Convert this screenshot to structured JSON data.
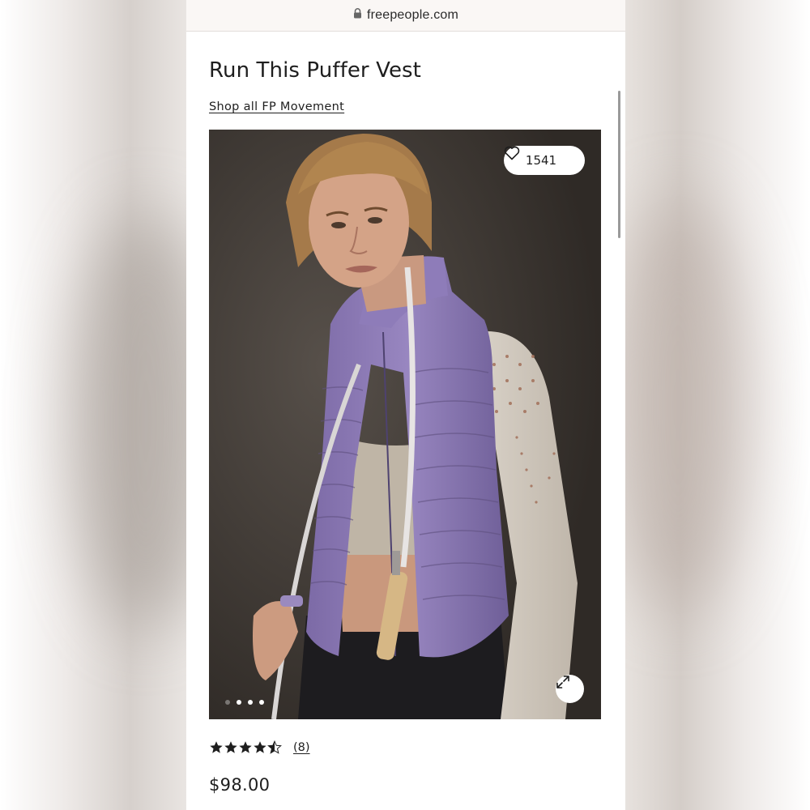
{
  "browser": {
    "url": "freepeople.com",
    "lock_icon": "lock-icon"
  },
  "product": {
    "title": "Run This Puffer Vest",
    "shop_link": "Shop all FP Movement",
    "favorites_count": "1541",
    "favorite_icon": "heart-outline-icon",
    "expand_icon": "expand-arrows-icon",
    "gallery": {
      "total_images_dots": 4,
      "active_index": 1
    },
    "rating": {
      "value": 4.5,
      "max": 5,
      "review_count_label": "(8)"
    },
    "price": "$98.00"
  },
  "colors": {
    "vest": "#8a78b4",
    "text": "#1e1e1e",
    "photo_background": "#3c3732"
  }
}
